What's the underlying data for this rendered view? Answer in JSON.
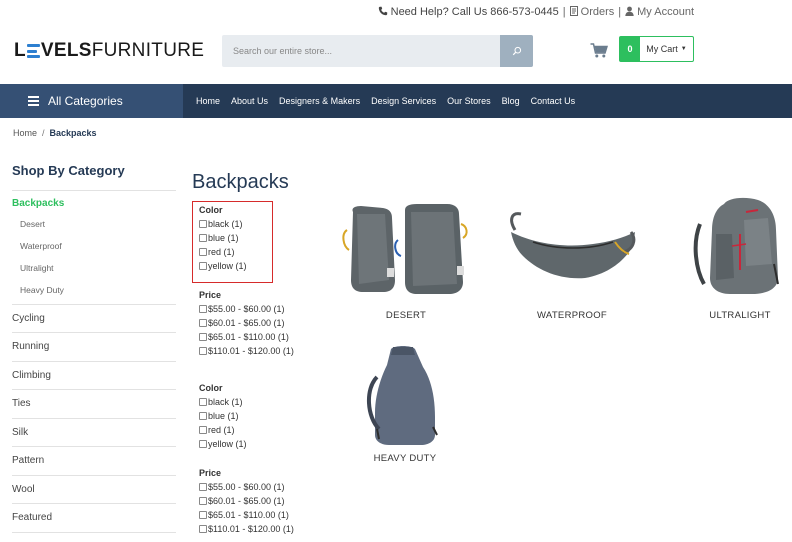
{
  "topbar": {
    "help": "Need Help? Call Us 866-573-0445",
    "orders": "Orders",
    "account": "My Account"
  },
  "logo": {
    "part1": "LEVELS",
    "part2": "FURNITURE"
  },
  "search": {
    "placeholder": "Search our entire store..."
  },
  "cart": {
    "count": "0",
    "label": "My Cart"
  },
  "nav": {
    "all_categories": "All Categories",
    "links": [
      "Home",
      "About Us",
      "Designers & Makers",
      "Design Services",
      "Our Stores",
      "Blog",
      "Contact Us"
    ]
  },
  "breadcrumb": {
    "home": "Home",
    "current": "Backpacks"
  },
  "sidebar": {
    "title": "Shop By Category",
    "active": "Backpacks",
    "subitems": [
      "Desert",
      "Waterproof",
      "Ultralight",
      "Heavy Duty"
    ],
    "items": [
      "Cycling",
      "Running",
      "Climbing",
      "Ties",
      "Silk",
      "Pattern",
      "Wool",
      "Featured"
    ]
  },
  "main": {
    "title": "Backpacks",
    "filters": [
      {
        "color_title": "Color",
        "colors": [
          "black (1)",
          "blue (1)",
          "red (1)",
          "yellow (1)"
        ],
        "price_title": "Price",
        "prices": [
          "$55.00 - $60.00 (1)",
          "$60.01 - $65.00 (1)",
          "$65.01 - $110.00 (1)",
          "$110.01 - $120.00 (1)"
        ]
      },
      {
        "color_title": "Color",
        "colors": [
          "black (1)",
          "blue (1)",
          "red (1)",
          "yellow (1)"
        ],
        "price_title": "Price",
        "prices": [
          "$55.00 - $60.00 (1)",
          "$60.01 - $65.00 (1)",
          "$65.01 - $110.00 (1)",
          "$110.01 - $120.00 (1)"
        ]
      }
    ],
    "products": [
      "DESERT",
      "WATERPROOF",
      "ULTRALIGHT",
      "HEAVY DUTY"
    ]
  },
  "colors": {
    "navy": "#253a55",
    "accent_green": "#2dbf5e",
    "highlight_red": "#d62b2b"
  }
}
